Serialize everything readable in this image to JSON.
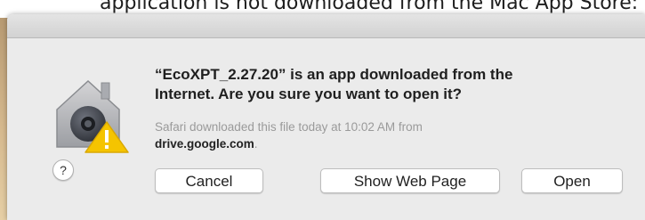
{
  "caption": "application is not downloaded from the Mac App Store: You'll see the following message:",
  "dialog": {
    "headline_line1": "“EcoXPT_2.27.20” is an app downloaded from the",
    "headline_line2": "Internet. Are you sure you want to open it?",
    "subtext_prefix": "Safari downloaded this file today at 10:02 AM from",
    "subtext_source": "drive.google.com",
    "subtext_suffix": ".",
    "icon": "gatekeeper-warning-icon",
    "help_label": "?",
    "buttons": {
      "cancel": "Cancel",
      "show_web_page": "Show Web Page",
      "open": "Open"
    }
  },
  "colors": {
    "dialog_background": "#ebebeb",
    "warning": "#f5c400",
    "lock": "#4a4e57"
  }
}
